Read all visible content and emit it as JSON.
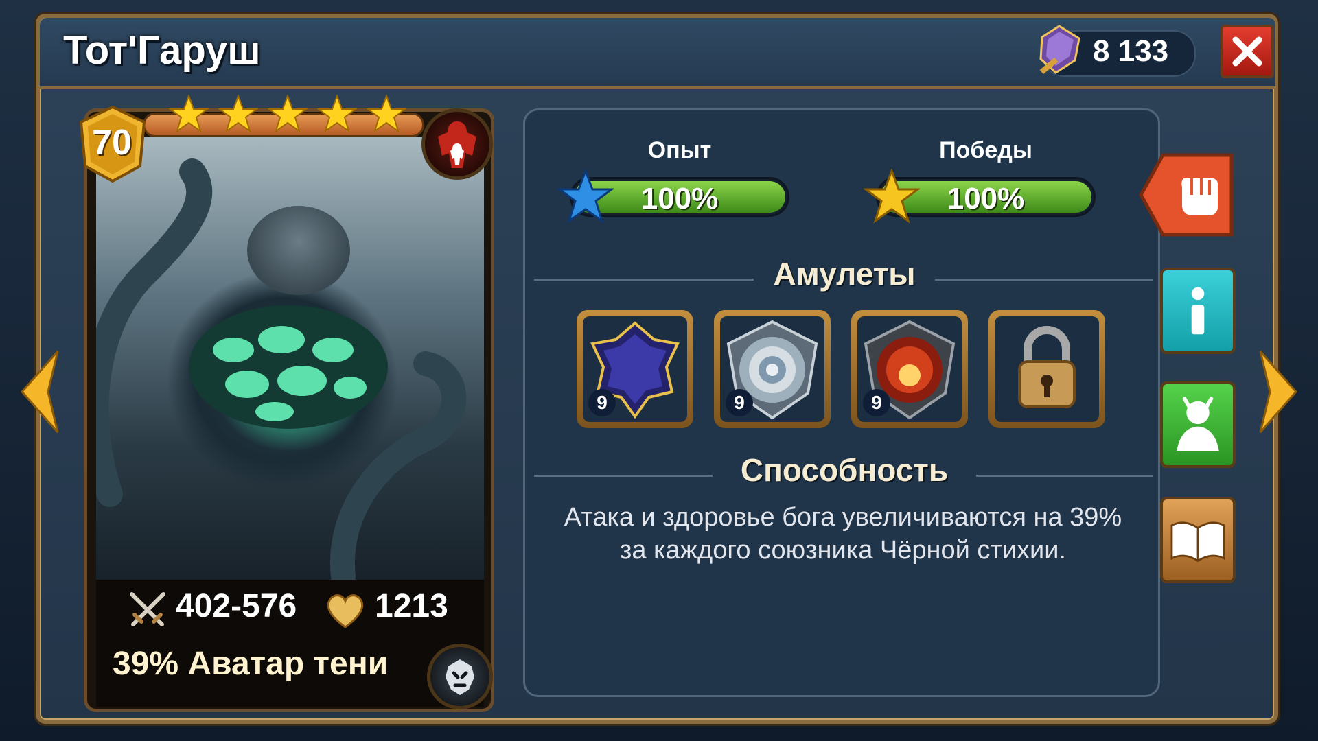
{
  "header": {
    "title": "Тот'Гаруш",
    "currency_value": "8 133",
    "close_label": "close"
  },
  "card": {
    "level": "70",
    "stars": 5,
    "attack": "402-576",
    "health": "1213",
    "skill": "39% Аватар тени"
  },
  "stats": {
    "experience_label": "Опыт",
    "experience_value": "100%",
    "experience_fraction": 1.0,
    "wins_label": "Победы",
    "wins_value": "100%",
    "wins_fraction": 1.0
  },
  "amulets": {
    "title": "Амулеты",
    "items": [
      {
        "name": "dark-amulet",
        "level": "9"
      },
      {
        "name": "air-amulet",
        "level": "9"
      },
      {
        "name": "fire-amulet",
        "level": "9"
      },
      {
        "name": "locked-slot",
        "level": ""
      }
    ]
  },
  "ability": {
    "title": "Способность",
    "text_line1": "Атака и здоровье бога увеличиваются на 39%",
    "text_line2": "за каждого союзника Чёрной стихии."
  },
  "icons": {
    "currency": "crystal-icon",
    "close": "close-icon",
    "class": "warrior-class-icon",
    "element": "shadow-element-icon",
    "attack": "crossed-swords-icon",
    "health": "heart-icon",
    "fight": "fist-icon",
    "info": "info-icon",
    "team": "team-icon",
    "book": "book-icon"
  },
  "colors": {
    "progress_green": "#4fa51f",
    "close_red": "#d23426",
    "gold_frame": "#b58438"
  }
}
